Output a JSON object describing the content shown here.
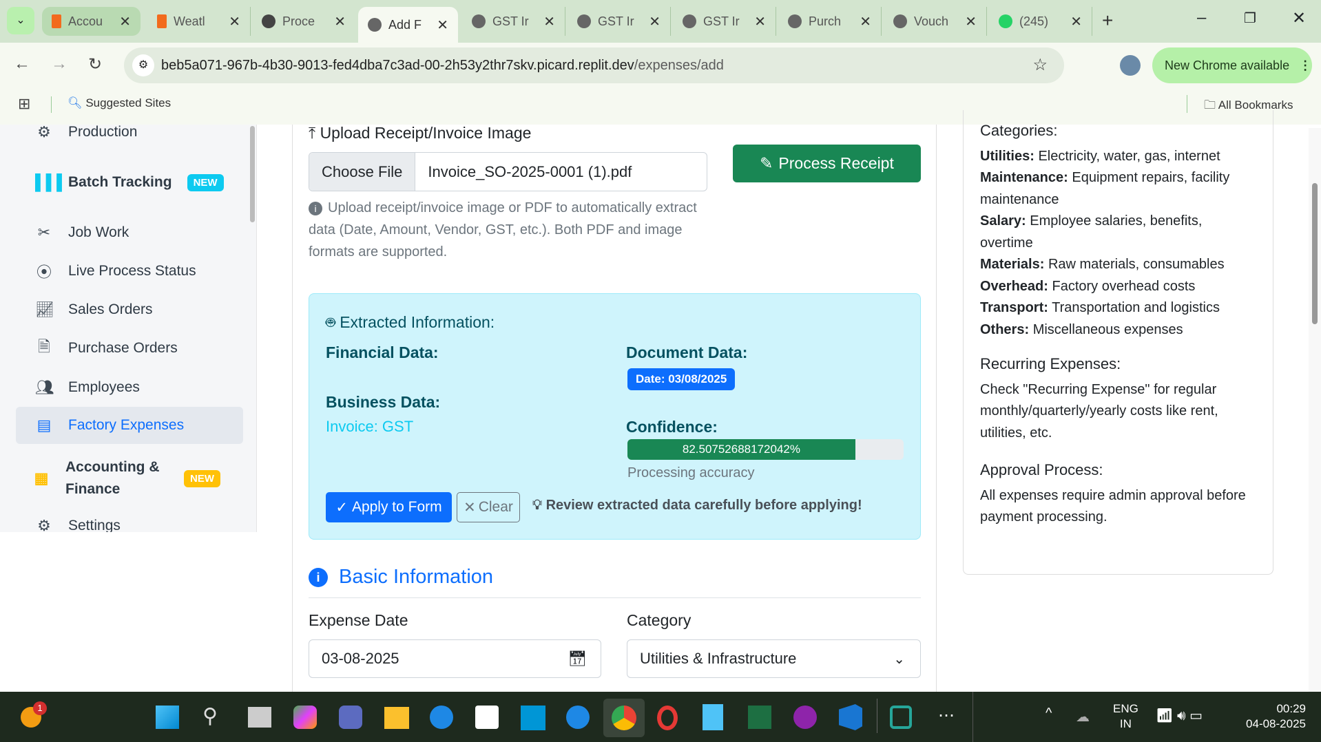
{
  "browser": {
    "tabs": [
      {
        "label": "Accou"
      },
      {
        "label": "Weatl"
      },
      {
        "label": "Proce"
      },
      {
        "label": "Add F",
        "active": true
      },
      {
        "label": "GST Ir"
      },
      {
        "label": "GST Ir"
      },
      {
        "label": "GST Ir"
      },
      {
        "label": "Purch"
      },
      {
        "label": "Vouch"
      },
      {
        "label": "(245)"
      }
    ],
    "url_host": "beb5a071-967b-4b30-9013-fed4dba7c3ad-00-2h53y2thr7skv.picard.replit.dev",
    "url_path": "/expenses/add",
    "new_chrome": "New Chrome available",
    "suggested_sites": "Suggested Sites",
    "all_bookmarks": "All Bookmarks"
  },
  "sidebar": {
    "items": [
      {
        "label": "Production",
        "icon": "gears-icon"
      },
      {
        "label": "Batch Tracking",
        "badge": "NEW",
        "icon": "barcode-icon"
      },
      {
        "label": "Job Work",
        "icon": "tools-icon"
      },
      {
        "label": "Live Process Status",
        "icon": "broadcast-icon"
      },
      {
        "label": "Sales Orders",
        "icon": "chart-line-icon"
      },
      {
        "label": "Purchase Orders",
        "icon": "file-icon"
      },
      {
        "label": "Employees",
        "icon": "users-icon"
      },
      {
        "label": "Factory Expenses",
        "icon": "receipt-icon",
        "active": true
      },
      {
        "label": "Accounting &",
        "label2": "Finance",
        "badge": "NEW",
        "icon": "calculator-icon"
      },
      {
        "label": "Settings",
        "icon": "gear-icon"
      }
    ]
  },
  "upload": {
    "title": "Upload Receipt/Invoice Image",
    "choose_file": "Choose File",
    "file_name": "Invoice_SO-2025-0001 (1).pdf",
    "process_button": "Process Receipt",
    "help": "Upload receipt/invoice image or PDF to automatically extract data (Date, Amount, Vendor, GST, etc.). Both PDF and image formats are supported."
  },
  "extracted": {
    "title": "Extracted Information:",
    "financial_title": "Financial Data:",
    "document_title": "Document Data:",
    "date_badge": "Date: 03/08/2025",
    "business_title": "Business Data:",
    "invoice": "Invoice: GST",
    "confidence_title": "Confidence:",
    "confidence_text": "82.50752688172042%",
    "confidence_value": 82.50752688172042,
    "processing": "Processing accuracy",
    "apply": "Apply to Form",
    "clear": "Clear",
    "warning": "Review extracted data carefully before applying!"
  },
  "basic": {
    "title": "Basic Information",
    "date_label": "Expense Date",
    "date_value": "03-08-2025",
    "category_label": "Category",
    "category_value": "Utilities & Infrastructure"
  },
  "help_card": {
    "categories_title": "Categories:",
    "categories": [
      {
        "name": "Utilities:",
        "desc": "Electricity, water, gas, internet"
      },
      {
        "name": "Maintenance:",
        "desc": "Equipment repairs, facility maintenance"
      },
      {
        "name": "Salary:",
        "desc": "Employee salaries, benefits, overtime"
      },
      {
        "name": "Materials:",
        "desc": "Raw materials, consumables"
      },
      {
        "name": "Overhead:",
        "desc": "Factory overhead costs"
      },
      {
        "name": "Transport:",
        "desc": "Transportation and logistics"
      },
      {
        "name": "Others:",
        "desc": "Miscellaneous expenses"
      }
    ],
    "recurring_title": "Recurring Expenses:",
    "recurring_text": "Check \"Recurring Expense\" for regular monthly/quarterly/yearly costs like rent, utilities, etc.",
    "approval_title": "Approval Process:",
    "approval_text": "All expenses require admin approval before payment processing."
  },
  "taskbar": {
    "notification_count": "1",
    "lang1": "ENG",
    "lang2": "IN",
    "time": "00:29",
    "date": "04-08-2025"
  },
  "colors": {
    "primary": "#0d6efd",
    "success": "#198754",
    "info_bg": "#cff4fc",
    "tabbar": "#d3e5cf"
  }
}
